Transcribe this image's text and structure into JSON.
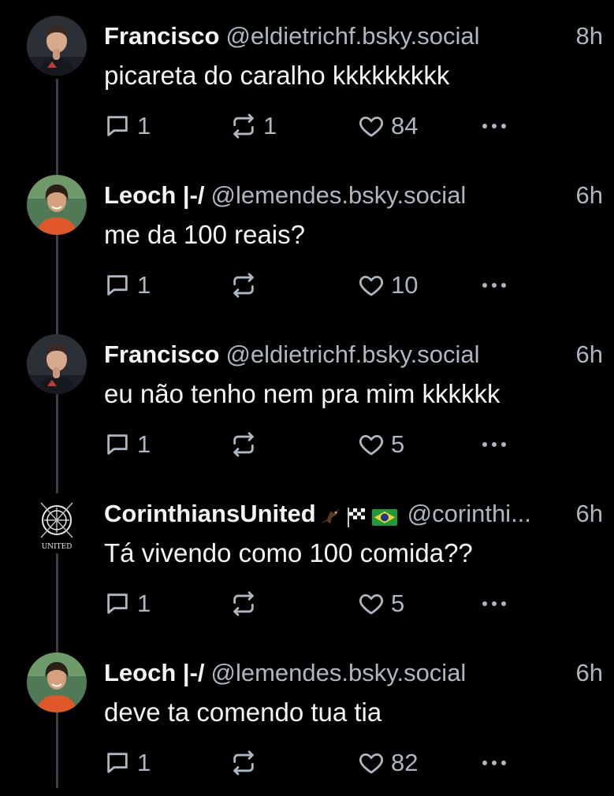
{
  "colors": {
    "background": "#000000",
    "text_primary": "#f2f4f6",
    "text_secondary": "#aeb6bf",
    "thread_line": "#3a3f46"
  },
  "posts": [
    {
      "name": "Francisco",
      "handle": "@eldietrichf.bsky.social",
      "time": "8h",
      "text": "picareta do caralho kkkkkkkkk",
      "reply_count": "1",
      "repost_count": "1",
      "like_count": "84",
      "avatar": "person-dark-avatar"
    },
    {
      "name": "Leoch |-/",
      "handle": "@lemendes.bsky.social",
      "time": "6h",
      "text": "me da 100 reais?",
      "reply_count": "1",
      "repost_count": "",
      "like_count": "10",
      "avatar": "person-orange-shirt-avatar"
    },
    {
      "name": "Francisco",
      "handle": "@eldietrichf.bsky.social",
      "time": "6h",
      "text": "eu não tenho nem pra mim kkkkkk",
      "reply_count": "1",
      "repost_count": "",
      "like_count": "5",
      "avatar": "person-dark-avatar"
    },
    {
      "name": "CorinthiansUnited",
      "handle": "@corinthi...",
      "time": "6h",
      "text": "Tá vivendo como 100 comida??",
      "reply_count": "1",
      "repost_count": "",
      "like_count": "5",
      "avatar": "corinthians-united-logo",
      "name_emojis": [
        "hawk-emoji",
        "checkered-flag-emoji",
        "brazil-flag-emoji"
      ]
    },
    {
      "name": "Leoch |-/",
      "handle": "@lemendes.bsky.social",
      "time": "6h",
      "text": "deve ta comendo tua tia",
      "reply_count": "1",
      "repost_count": "",
      "like_count": "82",
      "avatar": "person-orange-shirt-avatar"
    }
  ],
  "icons": {
    "reply": "reply-icon",
    "repost": "repost-icon",
    "like": "heart-icon",
    "more": "more-options-icon"
  }
}
